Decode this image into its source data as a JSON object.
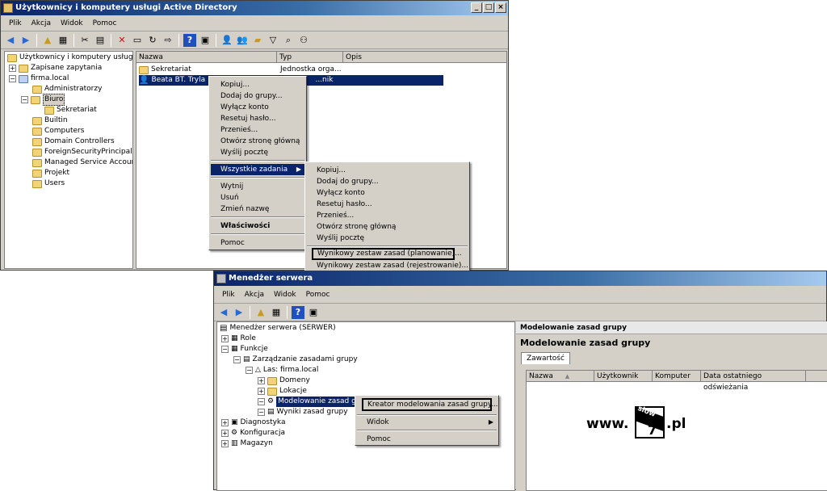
{
  "ad": {
    "title": "Użytkownicy i komputery usługi Active Directory",
    "menu": [
      "Plik",
      "Akcja",
      "Widok",
      "Pomoc"
    ],
    "tree": {
      "root": "Użytkownicy i komputery usługi Act",
      "saved": "Zapisane zapytania",
      "domain": "firma.local",
      "items": [
        "Administratorzy",
        "Biuro",
        "Sekretariat",
        "Builtin",
        "Computers",
        "Domain Controllers",
        "ForeignSecurityPrincipals",
        "Managed Service Accounts",
        "Projekt",
        "Users"
      ]
    },
    "columns": [
      "Nazwa",
      "Typ",
      "Opis"
    ],
    "rows": [
      {
        "name": "Sekretariat",
        "type": "Jednostka orga..."
      },
      {
        "name": "Beata BT. Tryla",
        "type": "...nik"
      }
    ],
    "context_menu": [
      "Kopiuj...",
      "Dodaj do grupy...",
      "Wyłącz konto",
      "Resetuj hasło...",
      "Przenieś...",
      "Otwórz stronę główną",
      "Wyślij pocztę",
      "Wszystkie zadania",
      "Wytnij",
      "Usuń",
      "Zmień nazwę",
      "Właściwości",
      "Pomoc"
    ],
    "submenu": [
      "Kopiuj...",
      "Dodaj do grupy...",
      "Wyłącz konto",
      "Resetuj hasło...",
      "Przenieś...",
      "Otwórz stronę główną",
      "Wyślij pocztę",
      "Wynikowy zestaw zasad (planowanie)...",
      "Wynikowy zestaw zasad (rejestrowanie)..."
    ]
  },
  "sm": {
    "title": "Menedżer serwera",
    "menu": [
      "Plik",
      "Akcja",
      "Widok",
      "Pomoc"
    ],
    "tree": {
      "root": "Menedżer serwera (SERWER)",
      "items": [
        "Role",
        "Funkcje",
        "Zarządzanie zasadami grupy",
        "Las: firma.local",
        "Domeny",
        "Lokacje",
        "Modelowanie zasad grupy",
        "Wyniki zasad grupy",
        "Diagnostyka",
        "Konfiguracja",
        "Magazyn"
      ]
    },
    "context_menu": [
      "Kreator modelowania zasad grupy...",
      "Widok",
      "Pomoc"
    ],
    "panel_header": "Modelowanie zasad grupy",
    "panel_title": "Modelowanie zasad grupy",
    "tab": "Zawartość",
    "columns": [
      "Nazwa",
      "Użytkownik",
      "Komputer",
      "Data ostatniego odświeżania"
    ]
  },
  "watermark": {
    "prefix": "www.",
    "top": "slow",
    "digit": "7",
    "suffix": ".pl"
  },
  "colors": {
    "titlebar": "#0a246a",
    "highlight": "#0a246a",
    "chrome": "#d4d0c8"
  }
}
